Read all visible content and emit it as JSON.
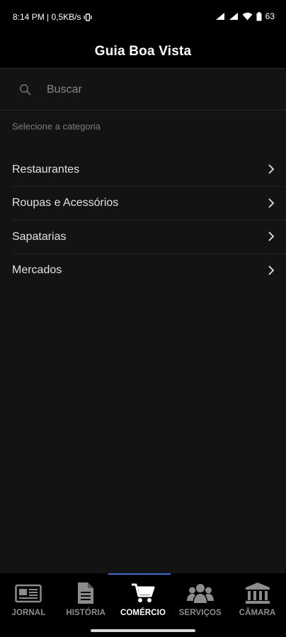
{
  "status_bar": {
    "time_and_speed": "8:14 PM | 0,5KB/s",
    "battery": "63"
  },
  "header": {
    "title": "Guia Boa Vista"
  },
  "search": {
    "placeholder": "Buscar"
  },
  "section_label": "Selecione a categoria",
  "categories": [
    {
      "label": "Restaurantes"
    },
    {
      "label": "Roupas e Acessórios"
    },
    {
      "label": "Sapatarias"
    },
    {
      "label": "Mercados"
    }
  ],
  "tabs": [
    {
      "label": "JORNAL",
      "icon": "newspaper-icon",
      "active": false
    },
    {
      "label": "HISTÓRIA",
      "icon": "document-icon",
      "active": false
    },
    {
      "label": "COMÉRCIO",
      "icon": "cart-icon",
      "active": true
    },
    {
      "label": "SERVIÇOS",
      "icon": "users-icon",
      "active": false
    },
    {
      "label": "CÂMARA",
      "icon": "bank-icon",
      "active": false
    }
  ],
  "colors": {
    "background": "#131313",
    "bar": "#000000",
    "active_indicator": "#3b6fd6"
  }
}
